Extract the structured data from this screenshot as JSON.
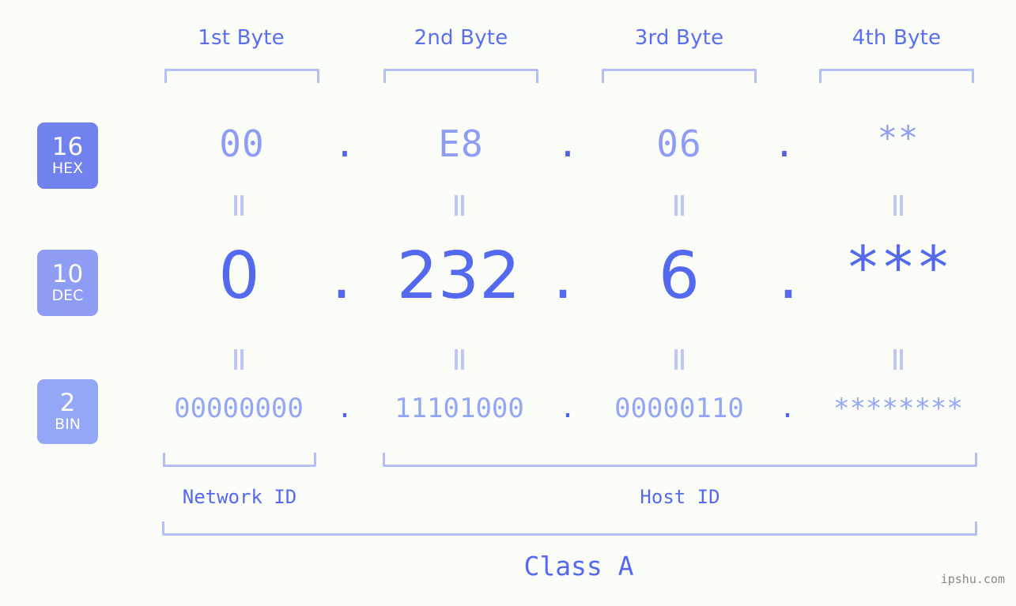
{
  "meta": {
    "background_color": "#fbfdf8",
    "accent_color": "#5569ee",
    "light_accent_color": "#94a6f6",
    "bracket_color": "#b5bdf7"
  },
  "byte_headers": [
    {
      "label": "1st Byte"
    },
    {
      "label": "2nd Byte"
    },
    {
      "label": "3rd Byte"
    },
    {
      "label": "4th Byte"
    }
  ],
  "rows": [
    {
      "base_number": "16",
      "base_name": "HEX",
      "badge_color": "#7181ee",
      "values": [
        "00",
        "E8",
        "06",
        "**"
      ],
      "separator": "."
    },
    {
      "base_number": "10",
      "base_name": "DEC",
      "badge_color": "#8f9cf3",
      "values": [
        "0",
        "232",
        "6",
        "***"
      ],
      "separator": "."
    },
    {
      "base_number": "2",
      "base_name": "BIN",
      "badge_color": "#94a6f6",
      "values": [
        "00000000",
        "11101000",
        "00000110",
        "********"
      ],
      "separator": "."
    }
  ],
  "id_sections": [
    {
      "label": "Network ID"
    },
    {
      "label": "Host ID"
    }
  ],
  "class": {
    "label": "Class A"
  },
  "watermark": {
    "text": "ipshu.com"
  }
}
